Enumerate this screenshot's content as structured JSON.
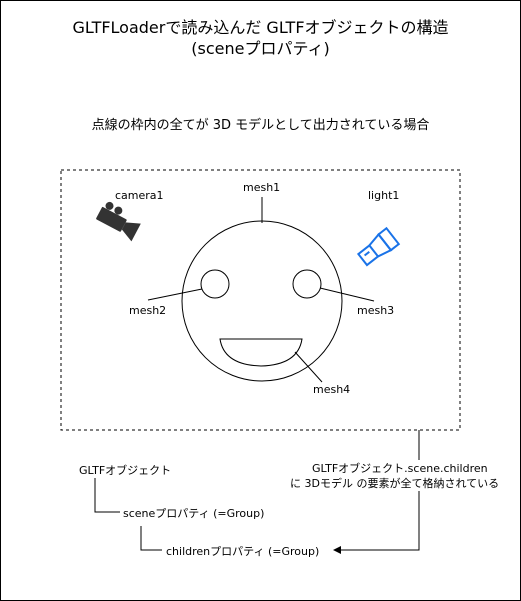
{
  "title_line1": "GLTFLoaderで読み込んだ GLTFオブジェクトの構造",
  "title_line2": "(sceneプロパティ)",
  "caption": "点線の枠内の全てが 3D モデルとして出力されている場合",
  "scene": {
    "camera_label": "camera1",
    "light_label": "light1",
    "mesh1_label": "mesh1",
    "mesh2_label": "mesh2",
    "mesh3_label": "mesh3",
    "mesh4_label": "mesh4"
  },
  "tree": {
    "root": "GLTFオブジェクト",
    "scene": "sceneプロパティ (=Group)",
    "children": "childrenプロパティ (=Group)"
  },
  "note_line1": "GLTFオブジェクト.scene.children",
  "note_line2": "に 3Dモデル の要素が全て格納されている",
  "colors": {
    "line": "#000000",
    "light_icon": "#1a73e8",
    "camera_icon": "#333333"
  }
}
